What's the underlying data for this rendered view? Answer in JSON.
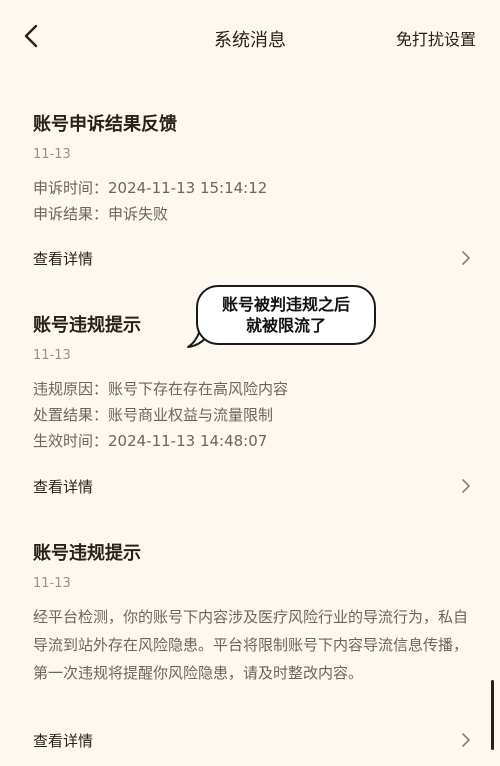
{
  "header": {
    "title": "系统消息",
    "action": "免打扰设置"
  },
  "messages": [
    {
      "title": "账号申诉结果反馈",
      "date": "11-13",
      "lines": [
        "申诉时间：2024-11-13 15:14:12",
        "申诉结果：申诉失败"
      ],
      "detail": "查看详情"
    },
    {
      "title": "账号违规提示",
      "date": "11-13",
      "lines": [
        "违规原因：账号下存在存在高风险内容",
        "处置结果：账号商业权益与流量限制",
        "生效时间：2024-11-13 14:48:07"
      ],
      "detail": "查看详情"
    },
    {
      "title": "账号违规提示",
      "date": "11-13",
      "paragraph": "经平台检测，你的账号下内容涉及医疗风险行业的导流行为，私自导流到站外存在风险隐患。平台将限制账号下内容导流信息传播，第一次违规将提醒你风险隐患，请及时整改内容。",
      "detail": "查看详情"
    }
  ],
  "annotation": {
    "line1": "账号被判违规之后",
    "line2": "就被限流了"
  },
  "icons": {
    "back": "chevron-left-icon",
    "detail": "chevron-right-icon"
  },
  "colors": {
    "background": "#fdf9f0",
    "title_text": "#2a2118",
    "body_text": "#6e655a",
    "date_text": "#9b9286"
  }
}
